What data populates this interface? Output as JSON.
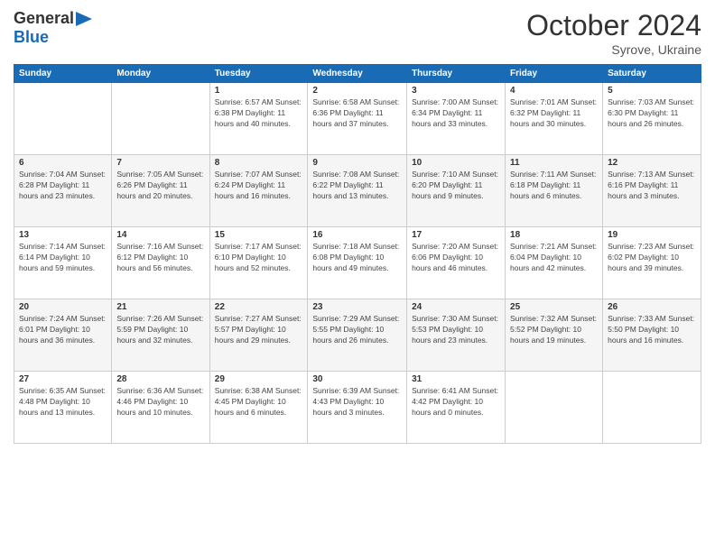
{
  "logo": {
    "line1": "General",
    "line2": "Blue"
  },
  "header": {
    "month": "October 2024",
    "location": "Syrove, Ukraine"
  },
  "days_of_week": [
    "Sunday",
    "Monday",
    "Tuesday",
    "Wednesday",
    "Thursday",
    "Friday",
    "Saturday"
  ],
  "weeks": [
    [
      {
        "day": "",
        "info": ""
      },
      {
        "day": "",
        "info": ""
      },
      {
        "day": "1",
        "info": "Sunrise: 6:57 AM\nSunset: 6:38 PM\nDaylight: 11 hours and 40 minutes."
      },
      {
        "day": "2",
        "info": "Sunrise: 6:58 AM\nSunset: 6:36 PM\nDaylight: 11 hours and 37 minutes."
      },
      {
        "day": "3",
        "info": "Sunrise: 7:00 AM\nSunset: 6:34 PM\nDaylight: 11 hours and 33 minutes."
      },
      {
        "day": "4",
        "info": "Sunrise: 7:01 AM\nSunset: 6:32 PM\nDaylight: 11 hours and 30 minutes."
      },
      {
        "day": "5",
        "info": "Sunrise: 7:03 AM\nSunset: 6:30 PM\nDaylight: 11 hours and 26 minutes."
      }
    ],
    [
      {
        "day": "6",
        "info": "Sunrise: 7:04 AM\nSunset: 6:28 PM\nDaylight: 11 hours and 23 minutes."
      },
      {
        "day": "7",
        "info": "Sunrise: 7:05 AM\nSunset: 6:26 PM\nDaylight: 11 hours and 20 minutes."
      },
      {
        "day": "8",
        "info": "Sunrise: 7:07 AM\nSunset: 6:24 PM\nDaylight: 11 hours and 16 minutes."
      },
      {
        "day": "9",
        "info": "Sunrise: 7:08 AM\nSunset: 6:22 PM\nDaylight: 11 hours and 13 minutes."
      },
      {
        "day": "10",
        "info": "Sunrise: 7:10 AM\nSunset: 6:20 PM\nDaylight: 11 hours and 9 minutes."
      },
      {
        "day": "11",
        "info": "Sunrise: 7:11 AM\nSunset: 6:18 PM\nDaylight: 11 hours and 6 minutes."
      },
      {
        "day": "12",
        "info": "Sunrise: 7:13 AM\nSunset: 6:16 PM\nDaylight: 11 hours and 3 minutes."
      }
    ],
    [
      {
        "day": "13",
        "info": "Sunrise: 7:14 AM\nSunset: 6:14 PM\nDaylight: 10 hours and 59 minutes."
      },
      {
        "day": "14",
        "info": "Sunrise: 7:16 AM\nSunset: 6:12 PM\nDaylight: 10 hours and 56 minutes."
      },
      {
        "day": "15",
        "info": "Sunrise: 7:17 AM\nSunset: 6:10 PM\nDaylight: 10 hours and 52 minutes."
      },
      {
        "day": "16",
        "info": "Sunrise: 7:18 AM\nSunset: 6:08 PM\nDaylight: 10 hours and 49 minutes."
      },
      {
        "day": "17",
        "info": "Sunrise: 7:20 AM\nSunset: 6:06 PM\nDaylight: 10 hours and 46 minutes."
      },
      {
        "day": "18",
        "info": "Sunrise: 7:21 AM\nSunset: 6:04 PM\nDaylight: 10 hours and 42 minutes."
      },
      {
        "day": "19",
        "info": "Sunrise: 7:23 AM\nSunset: 6:02 PM\nDaylight: 10 hours and 39 minutes."
      }
    ],
    [
      {
        "day": "20",
        "info": "Sunrise: 7:24 AM\nSunset: 6:01 PM\nDaylight: 10 hours and 36 minutes."
      },
      {
        "day": "21",
        "info": "Sunrise: 7:26 AM\nSunset: 5:59 PM\nDaylight: 10 hours and 32 minutes."
      },
      {
        "day": "22",
        "info": "Sunrise: 7:27 AM\nSunset: 5:57 PM\nDaylight: 10 hours and 29 minutes."
      },
      {
        "day": "23",
        "info": "Sunrise: 7:29 AM\nSunset: 5:55 PM\nDaylight: 10 hours and 26 minutes."
      },
      {
        "day": "24",
        "info": "Sunrise: 7:30 AM\nSunset: 5:53 PM\nDaylight: 10 hours and 23 minutes."
      },
      {
        "day": "25",
        "info": "Sunrise: 7:32 AM\nSunset: 5:52 PM\nDaylight: 10 hours and 19 minutes."
      },
      {
        "day": "26",
        "info": "Sunrise: 7:33 AM\nSunset: 5:50 PM\nDaylight: 10 hours and 16 minutes."
      }
    ],
    [
      {
        "day": "27",
        "info": "Sunrise: 6:35 AM\nSunset: 4:48 PM\nDaylight: 10 hours and 13 minutes."
      },
      {
        "day": "28",
        "info": "Sunrise: 6:36 AM\nSunset: 4:46 PM\nDaylight: 10 hours and 10 minutes."
      },
      {
        "day": "29",
        "info": "Sunrise: 6:38 AM\nSunset: 4:45 PM\nDaylight: 10 hours and 6 minutes."
      },
      {
        "day": "30",
        "info": "Sunrise: 6:39 AM\nSunset: 4:43 PM\nDaylight: 10 hours and 3 minutes."
      },
      {
        "day": "31",
        "info": "Sunrise: 6:41 AM\nSunset: 4:42 PM\nDaylight: 10 hours and 0 minutes."
      },
      {
        "day": "",
        "info": ""
      },
      {
        "day": "",
        "info": ""
      }
    ]
  ]
}
